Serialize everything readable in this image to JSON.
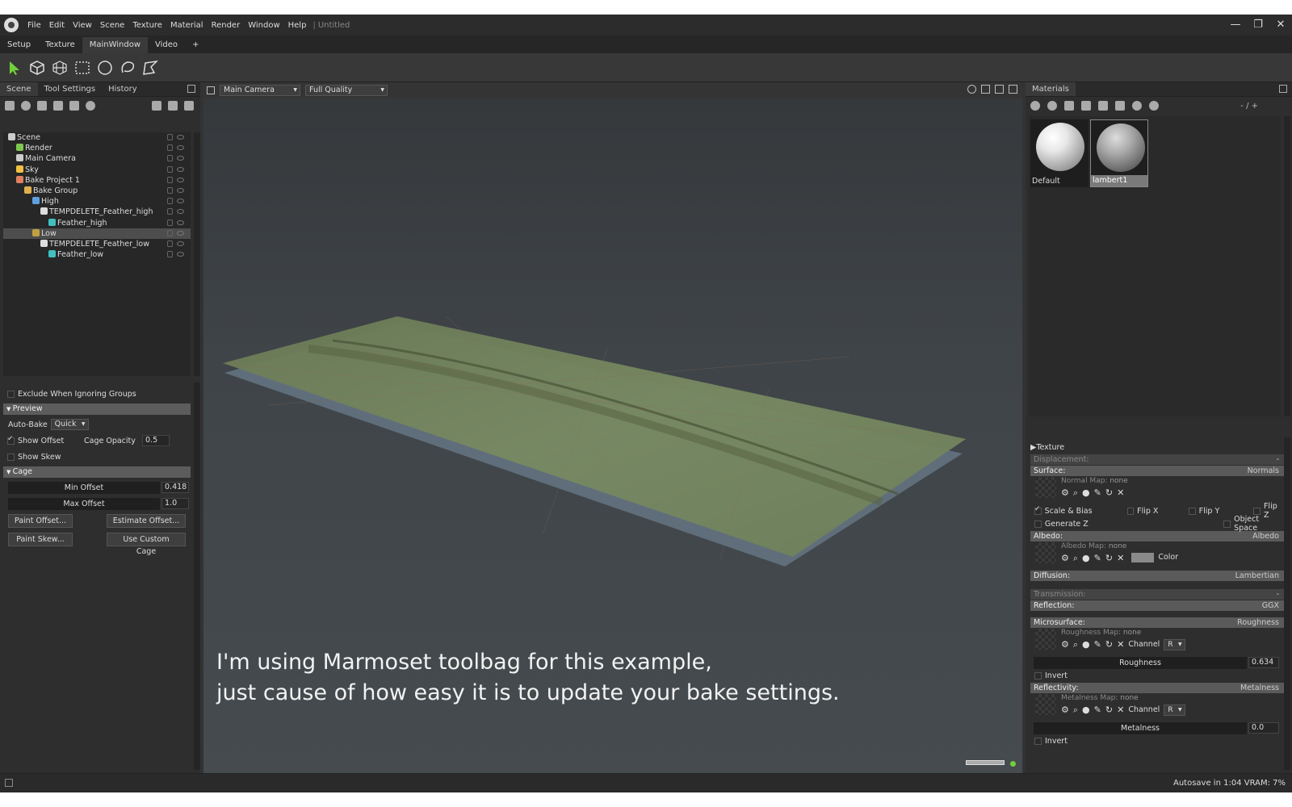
{
  "menu": {
    "items": [
      "File",
      "Edit",
      "View",
      "Scene",
      "Texture",
      "Material",
      "Render",
      "Window",
      "Help"
    ],
    "sep": "|",
    "doc_title": "Untitled"
  },
  "window_controls": {
    "minimize": "—",
    "restore": "❐",
    "close": "✕"
  },
  "workspace_tabs": [
    "Setup",
    "Texture",
    "MainWindow",
    "Video",
    "+"
  ],
  "active_workspace": "MainWindow",
  "left_panel": {
    "tabs": [
      "Scene",
      "Tool Settings",
      "History"
    ],
    "tree": [
      {
        "label": "Scene",
        "indent": 0,
        "icon": "scene-icon",
        "color": "#cccccc"
      },
      {
        "label": "Render",
        "indent": 1,
        "icon": "render-icon",
        "color": "#7ec850"
      },
      {
        "label": "Main Camera",
        "indent": 1,
        "icon": "camera-icon",
        "color": "#cccccc"
      },
      {
        "label": "Sky",
        "indent": 1,
        "icon": "sky-icon",
        "color": "#f0c040"
      },
      {
        "label": "Bake Project 1",
        "indent": 1,
        "icon": "bake-icon",
        "color": "#e08060"
      },
      {
        "label": "Bake Group",
        "indent": 2,
        "icon": "folder-icon",
        "color": "#e0b050"
      },
      {
        "label": "High",
        "indent": 3,
        "icon": "high-icon",
        "color": "#60a0e0"
      },
      {
        "label": "TEMPDELETE_Feather_high",
        "indent": 4,
        "icon": "file-icon",
        "color": "#dddddd"
      },
      {
        "label": "Feather_high",
        "indent": 5,
        "icon": "mesh-icon",
        "color": "#40c0c0"
      },
      {
        "label": "Low",
        "indent": 3,
        "icon": "low-icon",
        "color": "#c0a040",
        "selected": true
      },
      {
        "label": "TEMPDELETE_Feather_low",
        "indent": 4,
        "icon": "file-icon",
        "color": "#dddddd"
      },
      {
        "label": "Feather_low",
        "indent": 5,
        "icon": "mesh-icon",
        "color": "#40c0c0"
      }
    ],
    "exclude_label": "Exclude When Ignoring Groups",
    "preview_header": "Preview",
    "auto_bake_label": "Auto-Bake",
    "auto_bake_value": "Quick",
    "show_offset_label": "Show Offset",
    "cage_opacity_label": "Cage Opacity",
    "cage_opacity_value": "0.5",
    "show_skew_label": "Show Skew",
    "cage_header": "Cage",
    "min_offset_label": "Min Offset",
    "min_offset_value": "0.418",
    "max_offset_label": "Max Offset",
    "max_offset_value": "1.0",
    "paint_offset": "Paint Offset...",
    "estimate_offset": "Estimate Offset...",
    "paint_skew": "Paint Skew...",
    "use_custom_cage": "Use Custom Cage"
  },
  "viewport": {
    "camera": "Main Camera",
    "quality": "Full Quality",
    "caption_line1": "I'm using Marmoset toolbag for this example,",
    "caption_line2": "just cause of how easy it is to update your bake settings."
  },
  "right_panel": {
    "tab": "Materials",
    "counter": "- / +",
    "materials": [
      {
        "name": "Default",
        "selected": false
      },
      {
        "name": "lambert1",
        "selected": true
      }
    ],
    "texture_header": "Texture",
    "displacement_label": "Displacement:",
    "displacement_value": "-",
    "surface_label": "Surface:",
    "surface_value": "Normals",
    "normal_map_label": "Normal Map:",
    "normal_map_value": "none",
    "scale_bias": "Scale & Bias",
    "flip_x": "Flip X",
    "flip_y": "Flip Y",
    "flip_z": "Flip Z",
    "generate_z": "Generate Z",
    "object_space": "Object Space",
    "albedo_label": "Albedo:",
    "albedo_value": "Albedo",
    "albedo_map_label": "Albedo Map:",
    "albedo_map_value": "none",
    "color_label": "Color",
    "diffusion_label": "Diffusion:",
    "diffusion_value": "Lambertian",
    "transmission_label": "Transmission:",
    "transmission_value": "-",
    "reflection_label": "Reflection:",
    "reflection_value": "GGX",
    "microsurface_label": "Microsurface:",
    "microsurface_value": "Roughness",
    "roughness_map_label": "Roughness Map:",
    "roughness_map_value": "none",
    "channel_label": "Channel",
    "channel_value": "R",
    "roughness_label": "Roughness",
    "roughness_value": "0.634",
    "invert_label": "Invert",
    "reflectivity_label": "Reflectivity:",
    "reflectivity_value": "Metalness",
    "metalness_map_label": "Metalness Map:",
    "metalness_map_value": "none",
    "metal_channel_value": "R",
    "metalness_label": "Metalness",
    "metalness_value": "0.0",
    "invert2_label": "Invert"
  },
  "status": {
    "text": "Autosave in 1:04   VRAM: 7%"
  }
}
